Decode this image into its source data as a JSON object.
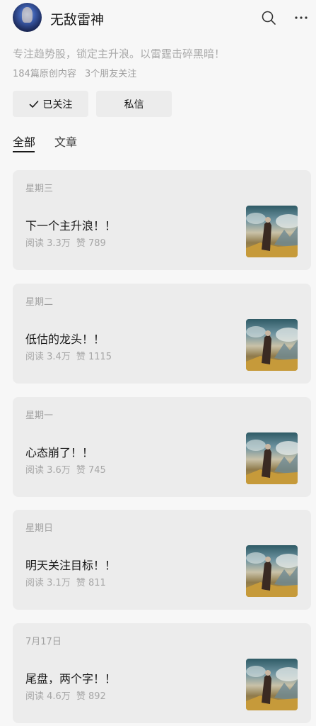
{
  "profile": {
    "name": "无敌雷神",
    "bio": "专注趋势股，锁定主升浪。以雷霆击碎黑暗！",
    "original_count": "184篇原创内容",
    "friends_following": "3个朋友关注"
  },
  "actions": {
    "follow_label": "已关注",
    "message_label": "私信"
  },
  "tabs": [
    {
      "label": "全部"
    },
    {
      "label": "文章"
    }
  ],
  "articles": [
    {
      "date": "星期三",
      "title": "下一个主升浪！！",
      "reads": "阅读 3.3万",
      "likes": "赞 789"
    },
    {
      "date": "星期二",
      "title": "低估的龙头！！",
      "reads": "阅读 3.4万",
      "likes": "赞 1115"
    },
    {
      "date": "星期一",
      "title": "心态崩了！！",
      "reads": "阅读 3.6万",
      "likes": "赞 745"
    },
    {
      "date": "星期日",
      "title": "明天关注目标！！",
      "reads": "阅读 3.1万",
      "likes": "赞 811"
    },
    {
      "date": "7月17日",
      "title": "尾盘，两个字！！",
      "reads": "阅读 4.6万",
      "likes": "赞 892"
    }
  ],
  "icons": {
    "search": "search-icon",
    "more": "more-icon",
    "check": "check-icon"
  }
}
